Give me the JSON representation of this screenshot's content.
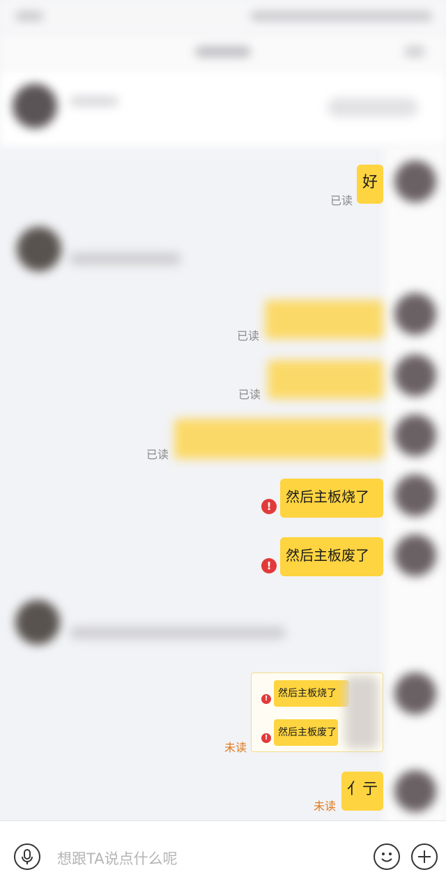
{
  "messages": [
    {
      "text": "好",
      "status": "已读"
    },
    {
      "text": "",
      "status": "已读"
    },
    {
      "text": "",
      "status": "已读"
    },
    {
      "text": "",
      "status": "已读"
    },
    {
      "text": "然后主板烧了",
      "status": "failed"
    },
    {
      "text": "然后主板废了",
      "status": "failed"
    },
    {
      "text": "亻亍",
      "status": "未读"
    }
  ],
  "forwarded": {
    "items": [
      "然后主板烧了",
      "然后主板废了"
    ],
    "status": "未读"
  },
  "input": {
    "placeholder": "想跟TA说点什么呢"
  },
  "icons": {
    "voice": "microphone-icon",
    "emoji": "smiley-icon",
    "more": "plus-icon",
    "error": "exclamation-icon"
  },
  "colors": {
    "bubble": "#fed440",
    "unread": "#e07a1e",
    "error": "#e23a3a",
    "background": "#f2f3f6"
  }
}
